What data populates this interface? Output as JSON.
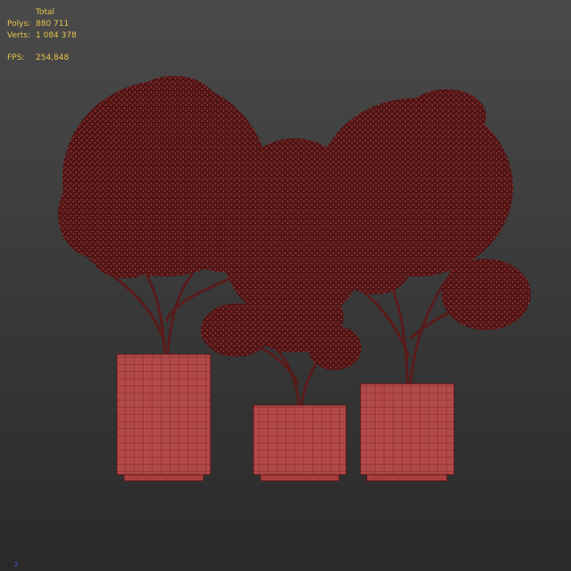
{
  "stats": {
    "header": "Total",
    "polys_label": "Polys:",
    "polys_value": "880 711",
    "verts_label": "Verts:",
    "verts_value": "1 084 378",
    "fps_label": "FPS:",
    "fps_value": "254,848"
  },
  "axis_label": "z",
  "colors": {
    "background_top": "#4a4a4a",
    "background_bottom": "#2a2a2a",
    "wire": "#8a2020",
    "pot_fill": "#b24848",
    "foliage": "#5a1818",
    "stats_text": "#e6c54a",
    "axis_text": "#3d5bd8"
  },
  "scene": {
    "objects": [
      "left-potted-tree",
      "middle-potted-tree",
      "right-potted-tree"
    ]
  }
}
